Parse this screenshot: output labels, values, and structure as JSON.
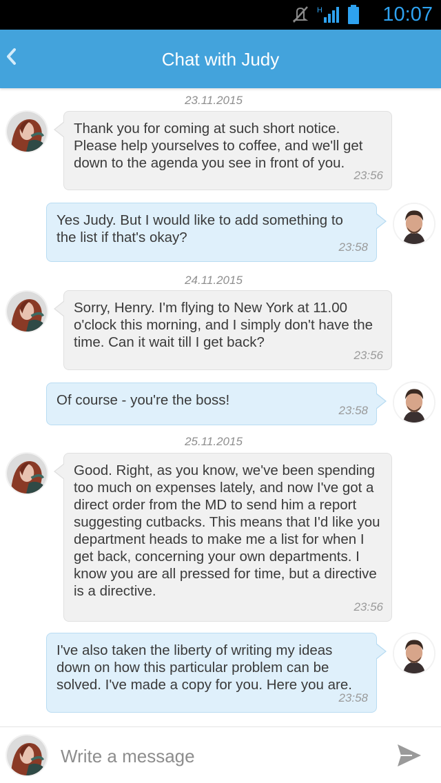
{
  "status_bar": {
    "time": "10:07",
    "network": "H",
    "icons": [
      "mute-icon",
      "signal-icon",
      "battery-icon"
    ]
  },
  "header": {
    "title": "Chat with Judy",
    "back_icon": "chevron-left-icon"
  },
  "colors": {
    "app_bar": "#43a3dc",
    "incoming_bubble": "#f1f1f1",
    "outgoing_bubble": "#dff0fb",
    "outgoing_border": "#b9dcf2"
  },
  "conversation": {
    "dates": [
      "23.11.2015",
      "24.11.2015",
      "25.11.2015"
    ],
    "messages": [
      {
        "sender": "Judy",
        "direction": "incoming",
        "text": "Thank you for coming at such short notice.\nPlease help yourselves to coffee, and we'll get\ndown to the agenda you see in front of you.",
        "time": "23:56"
      },
      {
        "sender": "Henry",
        "direction": "outgoing",
        "text": "Yes Judy. But I would like to add something to\nthe list if that's okay?",
        "time": "23:58"
      },
      {
        "sender": "Judy",
        "direction": "incoming",
        "text": "Sorry, Henry. I'm flying to New York at 11.00\no'clock this morning, and I simply don't have the\ntime. Can it wait till I get back?",
        "time": "23:56"
      },
      {
        "sender": "Henry",
        "direction": "outgoing",
        "text": "Of course - you're the boss!",
        "time": "23:58"
      },
      {
        "sender": "Judy",
        "direction": "incoming",
        "text": "Good. Right, as you know, we've been spending\ntoo much on expenses lately, and now I've got a\ndirect order from the MD to send him a report\nsuggesting cutbacks. This means that I'd like you\ndepartment heads to make me a list for when I\nget back, concerning your own departments. I\nknow you are all pressed for time, but a directive\nis a directive.",
        "time": "23:56"
      },
      {
        "sender": "Henry",
        "direction": "outgoing",
        "text": "I've also taken the liberty of writing my ideas\ndown on how this particular problem can be\nsolved. I've made a copy for you. Here you are.",
        "time": "23:58"
      }
    ]
  },
  "composer": {
    "placeholder": "Write a message",
    "value": "",
    "send_icon": "send-icon"
  }
}
